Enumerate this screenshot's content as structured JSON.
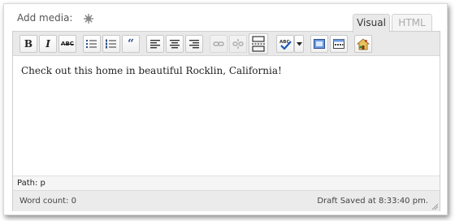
{
  "media": {
    "label": "Add media:",
    "icon": "star-icon"
  },
  "tabs": [
    {
      "label": "Visual",
      "active": true
    },
    {
      "label": "HTML",
      "active": false
    }
  ],
  "toolbar": {
    "bold": "B",
    "italic": "I",
    "strike": "ABC",
    "buttons": [
      "bold-icon",
      "italic-icon",
      "strikethrough-icon",
      "bullet-list-icon",
      "numbered-list-icon",
      "blockquote-icon",
      "align-left-icon",
      "align-center-icon",
      "align-right-icon",
      "link-icon",
      "unlink-icon",
      "more-tag-icon",
      "spellcheck-icon",
      "spellcheck-dropdown-icon",
      "fullscreen-icon",
      "kitchen-sink-icon",
      "house-icon"
    ]
  },
  "content": {
    "text": "Check out this home in beautiful Rocklin, California!"
  },
  "path": {
    "label": "Path: p"
  },
  "status": {
    "word_count": "Word count: 0",
    "draft_saved": "Draft Saved at 8:33:40 pm."
  },
  "colors": {
    "toolbar_bg": "#e9e9e9",
    "status_bg": "#ebebeb",
    "tab_active_bg": "#e9e9e9"
  }
}
